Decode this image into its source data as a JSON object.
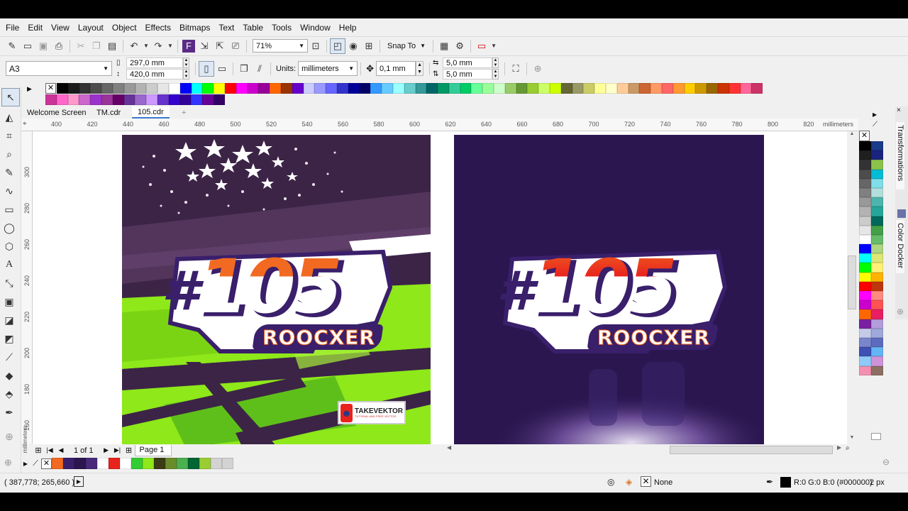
{
  "menu": [
    "File",
    "Edit",
    "View",
    "Layout",
    "Object",
    "Effects",
    "Bitmaps",
    "Text",
    "Table",
    "Tools",
    "Window",
    "Help"
  ],
  "toolbar": {
    "zoom": "71%",
    "snap_to": "Snap To"
  },
  "property_bar": {
    "page_preset": "A3",
    "width": "297,0 mm",
    "height": "420,0 mm",
    "units_label": "Units:",
    "units": "millimeters",
    "nudge": "0,1 mm",
    "dup_x": "5,0 mm",
    "dup_y": "5,0 mm"
  },
  "tabs": [
    "Welcome Screen",
    "TM.cdr",
    "105.cdr"
  ],
  "ruler": {
    "ticks": [
      "400",
      "420",
      "440",
      "460",
      "480",
      "500",
      "520",
      "540",
      "560",
      "580",
      "600",
      "620",
      "640",
      "660",
      "680",
      "700",
      "720",
      "740",
      "760",
      "780",
      "800",
      "820"
    ],
    "unit": "millimeters",
    "v_ticks": [
      "300",
      "280",
      "260",
      "240",
      "220",
      "200",
      "180",
      "160"
    ]
  },
  "artwork": {
    "number_hash": "#",
    "number": "105",
    "name": "ROOCXER",
    "watermark": "TAKEVEKTOR",
    "watermark_sub": "TUTORIAL AND FREE VECTOR"
  },
  "page_nav": {
    "count": "1 of 1",
    "page": "Page 1"
  },
  "dockers": [
    "Transformations",
    "Color Docker"
  ],
  "status": {
    "coords": "( 387,778; 265,660 )",
    "fill_none": "None",
    "outline": "R:0 G:0 B:0 (#000000)",
    "outline_width": "2 px"
  },
  "colors": {
    "bg_purple": "#2b1650",
    "orange": "#f26a21",
    "red": "#e8231d",
    "lime": "#8ee81a",
    "plum": "#3c2447"
  },
  "palette_top": [
    "#000000",
    "#1a1a1a",
    "#333333",
    "#4d4d4d",
    "#666666",
    "#808080",
    "#999999",
    "#b3b3b3",
    "#cccccc",
    "#e6e6e6",
    "#ffffff",
    "#0000ff",
    "#00ffff",
    "#00ff00",
    "#ffff00",
    "#ff0000",
    "#ff00ff",
    "#cc00cc",
    "#990099",
    "#ff6600",
    "#993300",
    "#6600cc",
    "#ccccff",
    "#9999ff",
    "#6666ff",
    "#3333cc",
    "#000099",
    "#000066",
    "#3399ff",
    "#66ccff",
    "#99ffff",
    "#66cccc",
    "#339999",
    "#006666",
    "#009966",
    "#33cc99",
    "#00cc66",
    "#66ff99",
    "#99ff99",
    "#ccffcc",
    "#99cc66",
    "#669933",
    "#99cc33",
    "#ccff66",
    "#ccff00",
    "#666633",
    "#999966",
    "#cccc66",
    "#ffff99",
    "#ffffcc",
    "#ffcc99",
    "#cc9966",
    "#cc6633",
    "#ff9966",
    "#ff6666",
    "#ff9933",
    "#ffcc00",
    "#cc9900",
    "#996600",
    "#cc3300",
    "#ff3333",
    "#ff6699",
    "#cc3366"
  ],
  "palette_top2": [
    "#cc3399",
    "#ff66cc",
    "#ff99cc",
    "#cc66cc",
    "#9933cc",
    "#993399",
    "#660066",
    "#663399",
    "#9966cc",
    "#cc99ff",
    "#6633cc",
    "#3300cc",
    "#330099",
    "#3333ff",
    "#660099",
    "#330066"
  ],
  "palette_doc": [
    "#f26a21",
    "#3a1f6b",
    "#2b1650",
    "#4a2a7a",
    "#ffffff",
    "#e8231d",
    "#ffffff",
    "#33cc33",
    "#8ee81a",
    "#3c3c14",
    "#6b8c2a",
    "#4caf50",
    "#006633",
    "#9acd32",
    "#d3d3d3",
    "#d3d3d3"
  ],
  "palette_right": [
    "#000000",
    "#1a3a8a",
    "#1f1f1f",
    "#1a237e",
    "#333333",
    "#8bc34a",
    "#4d4d4d",
    "#00bcd4",
    "#666666",
    "#80deea",
    "#808080",
    "#b2dfdb",
    "#999999",
    "#4db6ac",
    "#b3b3b3",
    "#26a69a",
    "#cccccc",
    "#00695c",
    "#e6e6e6",
    "#43a047",
    "#ffffff",
    "#66bb6a",
    "#0000ff",
    "#aed581",
    "#00ffff",
    "#dce775",
    "#00ff00",
    "#fff176",
    "#ffff00",
    "#ffb300",
    "#ff0000",
    "#bf360c",
    "#ff00ff",
    "#ff8a80",
    "#cc00cc",
    "#ff5252",
    "#ff6600",
    "#e91e63",
    "#7b1fa2",
    "#b39ddb",
    "#c5cae9",
    "#9fa8da",
    "#7986cb",
    "#5c6bc0",
    "#3f51b5",
    "#64b5f6",
    "#90caf9",
    "#ce93d8",
    "#f48fb1",
    "#8d6e63"
  ]
}
